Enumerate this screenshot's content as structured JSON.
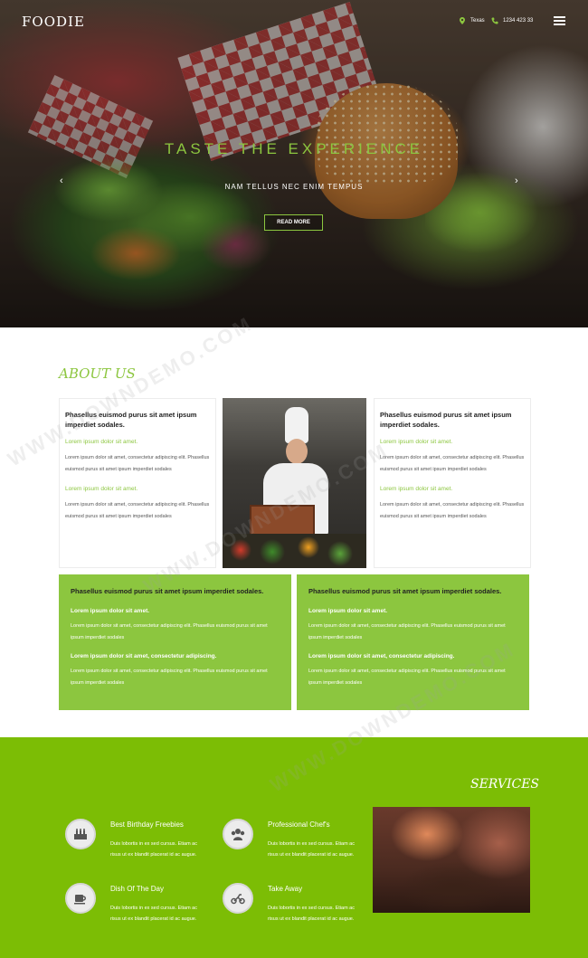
{
  "header": {
    "logo": "FOODIE",
    "location": "Texas",
    "phone": "1234 423 33",
    "menu_icon": "hamburger-icon"
  },
  "hero": {
    "title": "TASTE THE EXPERIENCE",
    "subtitle": "NAM TELLUS NEC ENIM TEMPUS",
    "button": "READ MORE",
    "prev_arrow": "‹",
    "next_arrow": "›"
  },
  "about": {
    "title": "ABOUT US",
    "left_card": {
      "heading": "Phasellus euismod purus sit amet ipsum imperdiet sodales.",
      "sub1": "Lorem ipsum dolor sit amet.",
      "text1": "Lorem ipsum dolor sit amet, consectetur adipiscing elit. Phasellus euismod purus sit amet ipsum imperdiet sodales",
      "sub2": "Lorem ipsum dolor sit amet.",
      "text2": "Lorem ipsum dolor sit amet, consectetur adipiscing elit. Phasellus euismod purus sit amet ipsum imperdiet sodales"
    },
    "right_card": {
      "heading": "Phasellus euismod purus sit amet ipsum imperdiet sodales.",
      "sub1": "Lorem ipsum dolor sit amet.",
      "text1": "Lorem ipsum dolor sit amet, consectetur adipiscing elit. Phasellus euismod purus sit amet ipsum imperdiet sodales",
      "sub2": "Lorem ipsum dolor sit amet.",
      "text2": "Lorem ipsum dolor sit amet, consectetur adipiscing elit. Phasellus euismod purus sit amet ipsum imperdiet sodales"
    },
    "green_left": {
      "heading": "Phasellus euismod purus sit amet ipsum imperdiet sodales.",
      "sub1": "Lorem ipsum dolor sit amet.",
      "text1": "Lorem ipsum dolor sit amet, consectetur adipiscing elit. Phasellus euismod purus sit amet ipsum imperdiet sodales",
      "sub2": "Lorem ipsum dolor sit amet, consectetur adipiscing.",
      "text2": "Lorem ipsum dolor sit amet, consectetur adipiscing elit. Phasellus euismod purus sit amet ipsum imperdiet sodales"
    },
    "green_right": {
      "heading": "Phasellus euismod purus sit amet ipsum imperdiet sodales.",
      "sub1": "Lorem ipsum dolor sit amet.",
      "text1": "Lorem ipsum dolor sit amet, consectetur adipiscing elit. Phasellus euismod purus sit amet ipsum imperdiet sodales",
      "sub2": "Lorem ipsum dolor sit amet, consectetur adipiscing.",
      "text2": "Lorem ipsum dolor sit amet, consectetur adipiscing elit. Phasellus euismod purus sit amet ipsum imperdiet sodales"
    }
  },
  "services": {
    "title": "SERVICES",
    "items": [
      {
        "name": "Best Birthday Freebies",
        "desc": "Duis lobortis in ex sed cursus. Etiam ac risus ut ex blandit placerat id ac augue.",
        "icon": "cake-icon"
      },
      {
        "name": "Professional Chef's",
        "desc": "Duis lobortis in ex sed cursus. Etiam ac risus ut ex blandit placerat id ac augue.",
        "icon": "chef-group-icon"
      },
      {
        "name": "Dish Of The Day",
        "desc": "Duis lobortis in ex sed cursus. Etiam ac risus ut ex blandit placerat id ac augue.",
        "icon": "coffee-cup-icon"
      },
      {
        "name": "Take Away",
        "desc": "Duis lobortis in ex sed cursus. Etiam ac risus ut ex blandit placerat id ac augue.",
        "icon": "scooter-icon"
      }
    ]
  },
  "watermark": "WWW.DOWNDEMO.COM",
  "colors": {
    "accent_green": "#8cc63f",
    "services_green": "#7cbd05",
    "white": "#ffffff",
    "heading_dark": "#222222"
  }
}
